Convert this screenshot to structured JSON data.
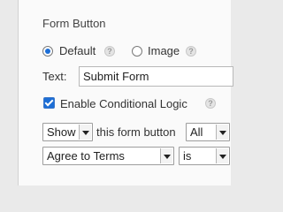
{
  "form_button": {
    "title": "Form Button",
    "options": [
      {
        "label": "Default",
        "selected": true
      },
      {
        "label": "Image",
        "selected": false
      }
    ],
    "help_glyph": "?",
    "text_label": "Text:",
    "text_value": "Submit Form"
  },
  "conditional_logic": {
    "enabled": true,
    "label": "Enable Conditional Logic",
    "action": "Show",
    "middle_text": "this form button",
    "match": "All",
    "field": "Agree to Terms",
    "operator": "is"
  },
  "colors": {
    "accent": "#1c6ed6",
    "panel_bg": "#fafafa",
    "page_bg": "#eaeaea"
  }
}
